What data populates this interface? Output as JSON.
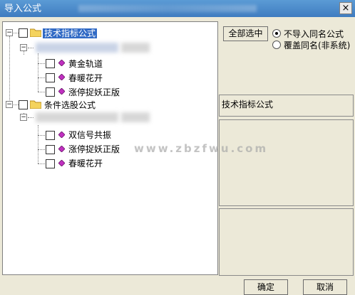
{
  "window": {
    "title": "导入公式",
    "close_label": "×"
  },
  "tree": {
    "groups": [
      {
        "label": "技术指标公式",
        "items": [
          "黄金轨道",
          "春暖花开",
          "涨停捉妖正版"
        ]
      },
      {
        "label": "条件选股公式",
        "items": [
          "双信号共振",
          "涨停捉妖正版",
          "春暖花开"
        ]
      }
    ],
    "expander_minus": "−"
  },
  "options": {
    "select_all": "全部选中",
    "radio_no_import": "不导入同名公式",
    "radio_overwrite": "覆盖同名(非系统)"
  },
  "info": {
    "formula_type": "技术指标公式"
  },
  "watermark": "www.zbzfwu.com",
  "footer": {
    "ok": "确定",
    "cancel": "取消"
  }
}
